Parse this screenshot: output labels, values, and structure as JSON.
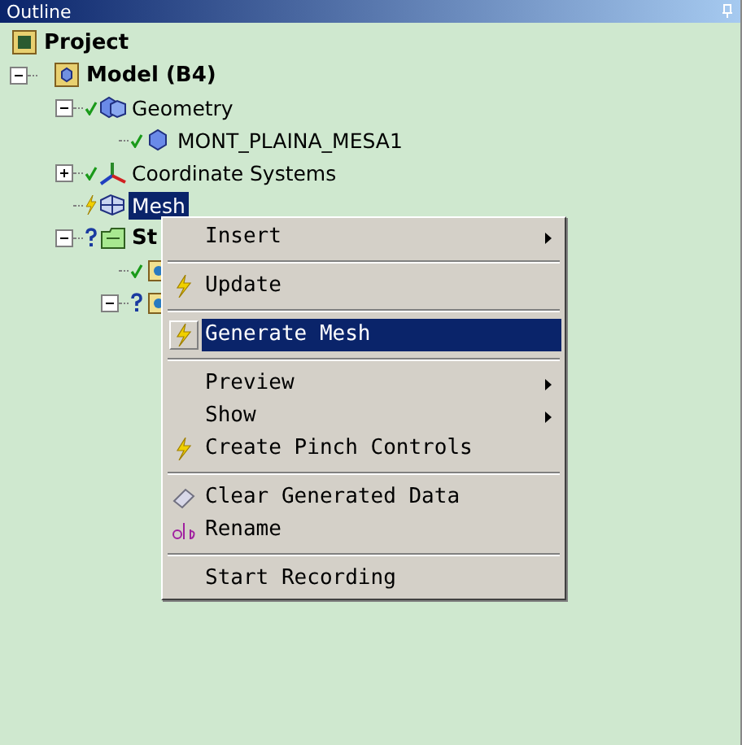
{
  "window": {
    "title": "Outline"
  },
  "tree": [
    {
      "kind": "project",
      "label": "Project",
      "bold": true,
      "selected": false,
      "children": [
        {
          "kind": "model",
          "label": "Model (B4)",
          "bold": true,
          "selected": false,
          "done": false,
          "outdated": false,
          "undefined": false,
          "expanded": true,
          "children": [
            {
              "kind": "geometry",
              "label": "Geometry",
              "bold": false,
              "selected": false,
              "done": true,
              "outdated": false,
              "undefined": false,
              "expanded": true,
              "children": [
                {
                  "kind": "body",
                  "label": "MONT_PLAINA_MESA1",
                  "bold": false,
                  "selected": false,
                  "done": true,
                  "outdated": false,
                  "undefined": false
                }
              ]
            },
            {
              "kind": "axes",
              "label": "Coordinate Systems",
              "bold": false,
              "selected": false,
              "done": true,
              "outdated": false,
              "undefined": false,
              "expanded": false
            },
            {
              "kind": "mesh",
              "label": "Mesh",
              "bold": false,
              "selected": true,
              "done": false,
              "outdated": true,
              "undefined": false
            },
            {
              "kind": "folder",
              "label": "St",
              "bold": true,
              "selected": false,
              "done": false,
              "outdated": false,
              "undefined": true,
              "expanded": true,
              "children": [
                {
                  "kind": "tool",
                  "done": true,
                  "outdated": false,
                  "undefined": false
                },
                {
                  "kind": "tool",
                  "done": false,
                  "outdated": false,
                  "undefined": true,
                  "expanded": true
                }
              ]
            }
          ]
        }
      ]
    }
  ],
  "context_menu": {
    "groups": [
      {
        "items": [
          {
            "kind": "plain",
            "label": "Insert",
            "submenu": true,
            "selected": false
          }
        ]
      },
      {
        "items": [
          {
            "kind": "bolt",
            "label": "Update",
            "submenu": false,
            "selected": false
          }
        ]
      },
      {
        "items": [
          {
            "kind": "bolt",
            "label": "Generate Mesh",
            "submenu": false,
            "selected": true
          }
        ]
      },
      {
        "items": [
          {
            "kind": "plain",
            "label": "Preview",
            "submenu": true,
            "selected": false
          },
          {
            "kind": "plain",
            "label": "Show",
            "submenu": true,
            "selected": false
          },
          {
            "kind": "bolt",
            "label": "Create Pinch Controls",
            "submenu": false,
            "selected": false
          }
        ]
      },
      {
        "items": [
          {
            "kind": "eraser",
            "label": "Clear Generated Data",
            "submenu": false,
            "selected": false
          },
          {
            "kind": "rename",
            "label": "Rename",
            "submenu": false,
            "selected": false
          }
        ]
      },
      {
        "items": [
          {
            "kind": "plain",
            "label": "Start Recording",
            "submenu": false,
            "selected": false
          }
        ]
      }
    ]
  }
}
